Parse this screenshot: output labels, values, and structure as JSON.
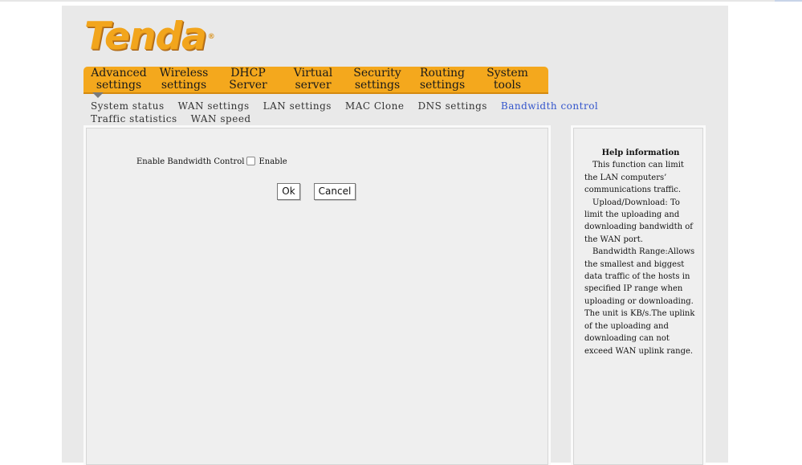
{
  "brand": {
    "logo_text": "Tenda",
    "registered_mark": "®"
  },
  "main_nav": [
    {
      "line1": "Advanced",
      "line2": "settings"
    },
    {
      "line1": "Wireless",
      "line2": "settings"
    },
    {
      "line1": "DHCP",
      "line2": "Server"
    },
    {
      "line1": "Virtual",
      "line2": "server"
    },
    {
      "line1": "Security",
      "line2": "settings"
    },
    {
      "line1": "Routing",
      "line2": "settings"
    },
    {
      "line1": "System",
      "line2": "tools"
    }
  ],
  "sub_nav": [
    "System status",
    "WAN settings",
    "LAN settings",
    "MAC Clone",
    "DNS settings",
    "Bandwidth control",
    "Traffic statistics",
    "WAN speed"
  ],
  "form": {
    "enable_label": "Enable Bandwidth Control",
    "checkbox_label": "Enable",
    "checkbox_checked": false,
    "ok_label": "Ok",
    "cancel_label": "Cancel"
  },
  "help": {
    "title": "Help information",
    "p1": "This function can limit the LAN computers’ communications traffic.",
    "p2": "Upload/Download: To limit the uploading and downloading bandwidth of the WAN port.",
    "p3": "Bandwidth Range:Allows the smallest and biggest data traffic of the hosts in specified IP range when uploading or downloading. The unit is KB/s.The uplink of the uploading and downloading can not exceed WAN uplink range."
  },
  "colors": {
    "accent": "#f4a81d",
    "active_link": "#3355cc",
    "page_bg": "#e9e9e9"
  }
}
